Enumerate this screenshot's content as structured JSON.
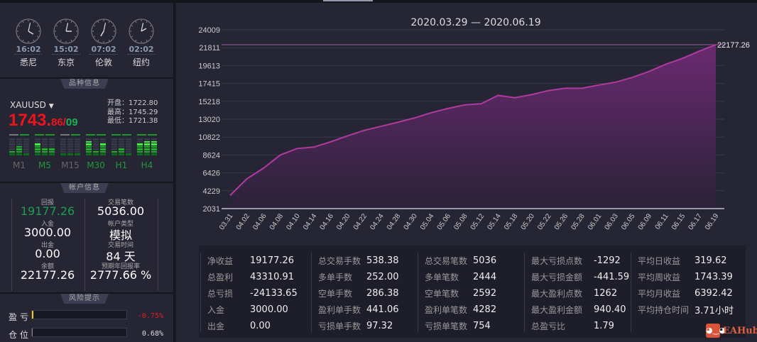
{
  "clocks": [
    {
      "time": "16:02",
      "city": "悉尼"
    },
    {
      "time": "15:02",
      "city": "东京"
    },
    {
      "time": "07:02",
      "city": "伦敦"
    },
    {
      "time": "02:02",
      "city": "纽约"
    }
  ],
  "sections": {
    "symbol_info": "品种信息",
    "account_info": "帐户信息",
    "risk": "风险提示"
  },
  "symbol": {
    "name": "XAUUSD",
    "price_main": "1743.",
    "price_frac": "86",
    "price_sep": "/",
    "price_spread": "09",
    "open_label": "开盘：",
    "open": "1722.80",
    "high_label": "最高：",
    "high": "1745.29",
    "low_label": "最低：",
    "low": "1721.38"
  },
  "timeframes": [
    {
      "label": "M1",
      "color": "#666",
      "levels": [
        0.3,
        0.6,
        0.1
      ]
    },
    {
      "label": "M5",
      "color": "#1f9a3a",
      "levels": [
        0.7,
        0.4,
        0.4
      ]
    },
    {
      "label": "M15",
      "color": "#666",
      "levels": [
        0.2,
        0.2,
        0.1
      ]
    },
    {
      "label": "M30",
      "color": "#1f9a3a",
      "levels": [
        0.9,
        0.3,
        0.7
      ]
    },
    {
      "label": "H1",
      "color": "#1f9a3a",
      "levels": [
        0.3,
        0.4,
        0.2
      ]
    },
    {
      "label": "H4",
      "color": "#1f9a3a",
      "levels": [
        0.7,
        0.9,
        0.9
      ]
    }
  ],
  "account": {
    "return_label": "回报",
    "return": "19177.26",
    "deposit_label": "入金",
    "deposit": "3000.00",
    "withdraw_label": "出金",
    "withdraw": "0.00",
    "balance_label": "余额",
    "balance": "22177.26",
    "trades_label": "交易笔数",
    "trades": "5036.00",
    "type_label": "帐户类型",
    "type": "模拟",
    "time_label": "交易时间",
    "time": "84 天",
    "annual_label": "预期年回报率",
    "annual": "2777.66 %"
  },
  "risk": {
    "pl_label": "盈亏",
    "pl": "-0.75%",
    "pl_fill": 0.01,
    "pos_label": "仓位",
    "pos": "0.68%",
    "pos_fill": 0.0068
  },
  "colors": {
    "line": "#b03aa0",
    "profit": "#19b450",
    "loss": "#f0141e"
  },
  "chart_data": {
    "type": "area",
    "title": "2020.03.29 — 2020.06.19",
    "last_label": "22177.26",
    "yticks": [
      "24009",
      "21811",
      "19613",
      "17415",
      "15218",
      "13020",
      "10822",
      "8624",
      "6426",
      "4229",
      "2031"
    ],
    "ylim": [
      2031,
      24009
    ],
    "x": [
      "03.31",
      "04.02",
      "04.06",
      "04.08",
      "04.10",
      "04.14",
      "04.16",
      "04.20",
      "04.22",
      "04.24",
      "04.28",
      "04.30",
      "05.04",
      "05.06",
      "05.08",
      "05.12",
      "05.14",
      "05.18",
      "05.20",
      "05.22",
      "05.26",
      "05.28",
      "06.01",
      "06.03",
      "06.05",
      "06.09",
      "06.11",
      "06.15",
      "06.17",
      "06.19"
    ],
    "values": [
      3643,
      5694,
      7013,
      8624,
      9417,
      9593,
      10237,
      10969,
      11643,
      12141,
      12639,
      13167,
      13811,
      14339,
      14779,
      14926,
      15951,
      15658,
      16039,
      16537,
      16830,
      16830,
      17211,
      17563,
      18149,
      18881,
      19760,
      20493,
      21372,
      22177.26
    ]
  },
  "stats": [
    [
      {
        "k": "净收益",
        "v": "19177.26"
      },
      {
        "k": "总盈利",
        "v": "43310.91"
      },
      {
        "k": "总亏损",
        "v": "-24133.65"
      },
      {
        "k": "入金",
        "v": "3000.00"
      },
      {
        "k": "出金",
        "v": "0.00"
      }
    ],
    [
      {
        "k": "总交易手数",
        "v": "538.38"
      },
      {
        "k": "多单手数",
        "v": "252.00"
      },
      {
        "k": "空单手数",
        "v": "286.38"
      },
      {
        "k": "盈利单手数",
        "v": "441.06"
      },
      {
        "k": "亏损单手数",
        "v": "97.32"
      }
    ],
    [
      {
        "k": "总交易笔数",
        "v": "5036"
      },
      {
        "k": "多单笔数",
        "v": "2444"
      },
      {
        "k": "空单笔数",
        "v": "2592"
      },
      {
        "k": "盈利单笔数",
        "v": "4282"
      },
      {
        "k": "亏损单笔数",
        "v": "754"
      }
    ],
    [
      {
        "k": "最大亏损点数",
        "v": "-1292"
      },
      {
        "k": "最大亏损金额",
        "v": "-441.59"
      },
      {
        "k": "最大盈利点数",
        "v": "1262"
      },
      {
        "k": "最大盈利金额",
        "v": "940.40"
      },
      {
        "k": "总盈亏比",
        "v": "1.79"
      }
    ],
    [
      {
        "k": "平均日收益",
        "v": "319.62"
      },
      {
        "k": "平均周收益",
        "v": "1743.39"
      },
      {
        "k": "平均月收益",
        "v": "6392.42"
      },
      {
        "k": "平均持仓时间",
        "v": "3.71小时"
      }
    ]
  ],
  "logo": "EAHub"
}
